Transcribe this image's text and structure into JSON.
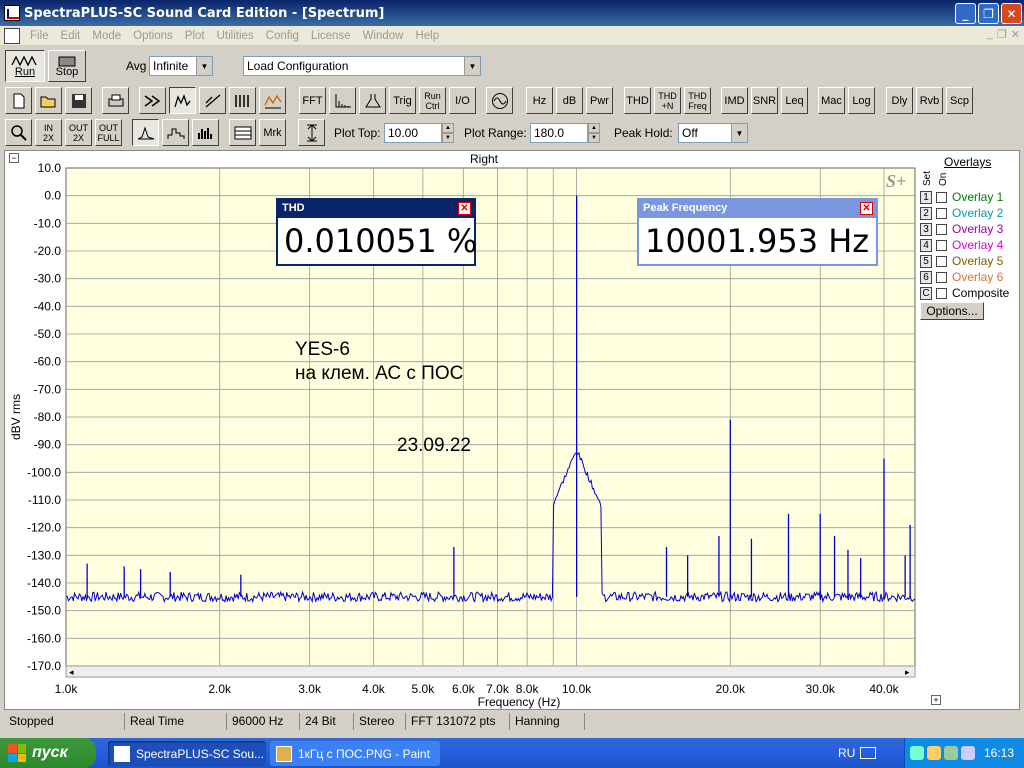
{
  "window": {
    "title": "SpectraPLUS-SC Sound Card Edition - [Spectrum]",
    "minimize": "_",
    "restore": "❐",
    "close": "✕"
  },
  "menu": [
    "File",
    "Edit",
    "Mode",
    "Options",
    "Plot",
    "Utilities",
    "Config",
    "License",
    "Window",
    "Help"
  ],
  "toolbar1": {
    "run_label": "Run",
    "stop_label": "Stop",
    "avg_label": "Avg",
    "avg_value": "Infinite",
    "config_value": "Load Configuration"
  },
  "toolbar2": {
    "buttons": [
      "FFT",
      "Trig",
      "Run Ctrl",
      "I/O",
      "Hz",
      "dB",
      "Pwr",
      "THD",
      "THD +N",
      "THD Freq",
      "IMD",
      "SNR",
      "Leq",
      "Mac",
      "Log",
      "Dly",
      "Rvb",
      "Scp"
    ]
  },
  "toolbar3": {
    "mrk_label": "Mrk",
    "plot_top_label": "Plot Top:",
    "plot_top_value": "10.00",
    "plot_range_label": "Plot Range:",
    "plot_range_value": "180.0",
    "peak_hold_label": "Peak Hold:",
    "peak_hold_value": "Off"
  },
  "plot": {
    "channel": "Right",
    "watermark": "S+",
    "y_label": "dBV rms",
    "x_label": "Frequency (Hz)",
    "y_ticks": [
      "10.0",
      "0.0",
      "-10.0",
      "-20.0",
      "-30.0",
      "-40.0",
      "-50.0",
      "-60.0",
      "-70.0",
      "-80.0",
      "-90.0",
      "-100.0",
      "-110.0",
      "-120.0",
      "-130.0",
      "-140.0",
      "-150.0",
      "-160.0",
      "-170.0"
    ],
    "x_ticks": [
      "1.0k",
      "2.0k",
      "3.0k",
      "4.0k",
      "5.0k",
      "6.0k",
      "7.0k",
      "8.0k",
      "10.0k",
      "20.0k",
      "30.0k",
      "40.0k"
    ]
  },
  "thd_meter": {
    "title": "THD",
    "value": "0.010051 %"
  },
  "peak_meter": {
    "title": "Peak Frequency",
    "value": "10001.953 Hz"
  },
  "annotation": {
    "line1": "YES-6",
    "line2": "на клем. АС с ПОС",
    "date": "23.09.22"
  },
  "overlays": {
    "header": "Overlays",
    "col_set": "Set",
    "col_on": "On",
    "items": [
      {
        "set": "1",
        "label": "Overlay 1",
        "color": "#008000"
      },
      {
        "set": "2",
        "label": "Overlay 2",
        "color": "#00a0a0"
      },
      {
        "set": "3",
        "label": "Overlay 3",
        "color": "#a000a0"
      },
      {
        "set": "4",
        "label": "Overlay 4",
        "color": "#e000e0"
      },
      {
        "set": "5",
        "label": "Overlay 5",
        "color": "#806000"
      },
      {
        "set": "6",
        "label": "Overlay 6",
        "color": "#e07030"
      },
      {
        "set": "C",
        "label": "Composite",
        "color": "#000000"
      }
    ],
    "options_button": "Options..."
  },
  "status": [
    "Stopped",
    "Real Time",
    "96000 Hz",
    "24 Bit",
    "Stereo",
    "FFT 131072 pts",
    "Hanning"
  ],
  "taskbar": {
    "start_label": "пуск",
    "tasks": [
      "SpectraPLUS-SC Sou...",
      "1кГц с ПОС.PNG - Paint"
    ],
    "lang": "RU",
    "clock": "16:13"
  },
  "chart_data": {
    "type": "line",
    "x_scale": "log",
    "xlim": [
      1000,
      46000
    ],
    "ylim": [
      -170,
      10
    ],
    "xlabel": "Frequency (Hz)",
    "ylabel": "dBV rms",
    "series": [
      {
        "color": "#0000cc",
        "noise_floor_db": -145,
        "peaks": [
          {
            "x": 10001.953,
            "y": 0
          },
          {
            "x": 1100,
            "y": -133
          },
          {
            "x": 1300,
            "y": -134
          },
          {
            "x": 1400,
            "y": -135
          },
          {
            "x": 1600,
            "y": -136
          },
          {
            "x": 2200,
            "y": -137
          },
          {
            "x": 5750,
            "y": -127
          },
          {
            "x": 15000,
            "y": -127
          },
          {
            "x": 16500,
            "y": -130
          },
          {
            "x": 20000,
            "y": -81
          },
          {
            "x": 19000,
            "y": -123
          },
          {
            "x": 22000,
            "y": -124
          },
          {
            "x": 26000,
            "y": -115
          },
          {
            "x": 30000,
            "y": -115
          },
          {
            "x": 32000,
            "y": -123
          },
          {
            "x": 34000,
            "y": -128
          },
          {
            "x": 36000,
            "y": -131
          },
          {
            "x": 40000,
            "y": -95
          },
          {
            "x": 44000,
            "y": -130
          },
          {
            "x": 45000,
            "y": -119
          }
        ]
      }
    ]
  }
}
